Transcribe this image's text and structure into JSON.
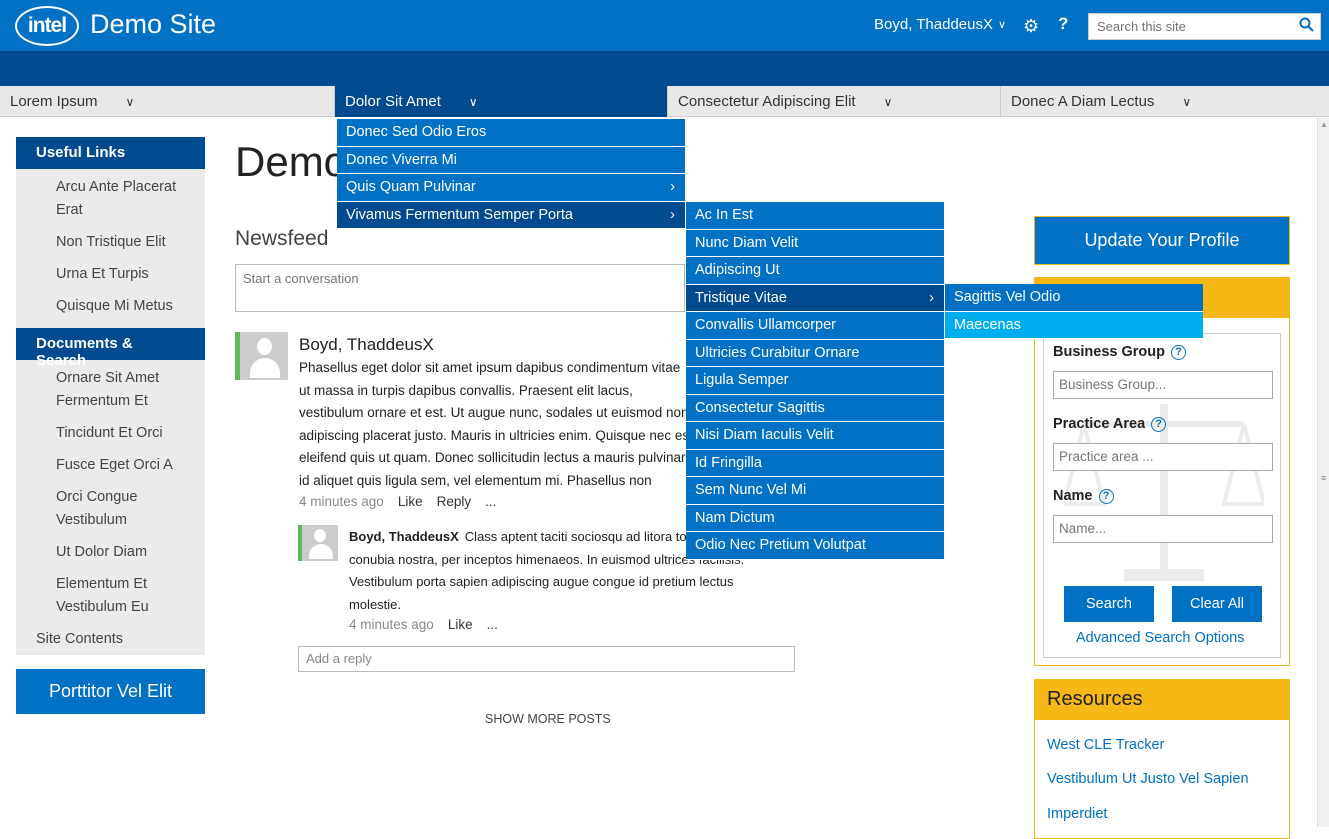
{
  "header": {
    "logo_text": "intel",
    "site_title": "Demo Site",
    "user_name": "Boyd, ThaddeusX",
    "help_label": "?",
    "search_placeholder": "Search this site"
  },
  "nav": {
    "items": [
      {
        "label": "Lorem Ipsum"
      },
      {
        "label": "Dolor Sit Amet"
      },
      {
        "label": "Consectetur Adipiscing Elit"
      },
      {
        "label": "Donec A Diam Lectus"
      }
    ]
  },
  "sidebar": {
    "useful_links_heading": "Useful Links",
    "useful_links": [
      "Arcu Ante Placerat Erat",
      "Non Tristique Elit",
      "Urna Et Turpis",
      "Quisque Mi Metus"
    ],
    "docs_heading": "Documents & Search",
    "docs_links": [
      "Ornare Sit Amet Fermentum Et",
      "Tincidunt Et Orci",
      "Fusce Eget Orci A",
      "Orci Congue Vestibulum",
      "Ut Dolor Diam",
      "Elementum Et Vestibulum Eu"
    ],
    "site_contents": "Site Contents",
    "cta_label": "Porttitor Vel Elit"
  },
  "main": {
    "page_title": "Demo",
    "newsfeed_heading": "Newsfeed",
    "conversation_placeholder": "Start a conversation",
    "post": {
      "author": "Boyd, ThaddeusX",
      "text": "Phasellus eget dolor sit amet ipsum dapibus condimentum vitae ut massa in turpis dapibus convallis. Praesent elit lacus, vestibulum ornare et est. Ut augue nunc, sodales ut euismod non, adipiscing placerat justo. Mauris in ultricies enim. Quisque nec est eleifend quis ut quam. Donec sollicitudin lectus a mauris pulvinar id aliquet quis ligula sem, vel elementum mi. Phasellus non ullamcorper u",
      "time": "4 minutes ago",
      "like": "Like",
      "reply": "Reply",
      "more": "..."
    },
    "reply": {
      "author": "Boyd, ThaddeusX",
      "text": "Class aptent taciti sociosqu ad litora torquent per conubia nostra, per inceptos himenaeos. In euismod ultrices facilisis. Vestibulum porta sapien adipiscing augue congue id pretium lectus molestie.",
      "time": "4 minutes ago",
      "like": "Like",
      "more": "..."
    },
    "add_reply_placeholder": "Add a reply",
    "show_more": "SHOW MORE POSTS"
  },
  "dropdown_level1": [
    "Donec Sed Odio Eros",
    "Donec Viverra Mi",
    "Quis Quam Pulvinar",
    "Vivamus Fermentum Semper Porta"
  ],
  "dropdown_level2": [
    "Ac In Est",
    "Nunc Diam Velit",
    "Adipiscing Ut",
    "Tristique Vitae",
    "Convallis Ullamcorper",
    "Ultricies Curabitur Ornare",
    "Ligula Semper",
    "Consectetur Sagittis",
    "Nisi Diam Iaculis Velit",
    "Id Fringilla",
    "Sem Nunc Vel Mi",
    "Nam Dictum",
    "Odio Nec Pretium Volutpat"
  ],
  "dropdown_level3": [
    "Sagittis Vel Odio",
    "Maecenas"
  ],
  "right": {
    "update_profile": "Update Your Profile",
    "business_group_label": "Business Group",
    "business_group_placeholder": "Business Group...",
    "practice_area_label": "Practice Area",
    "practice_area_placeholder": "Practice area ...",
    "name_label": "Name",
    "name_placeholder": "Name...",
    "search_btn": "Search",
    "clear_btn": "Clear All",
    "advanced_link": "Advanced Search Options",
    "resources_heading": "Resources",
    "resources_links": [
      "West CLE Tracker",
      "Vestibulum Ut Justo Vel Sapien",
      "Imperdiet"
    ]
  },
  "colors": {
    "brand_blue": "#0071c5",
    "dark_blue": "#004a8f",
    "accent_yellow": "#f5b817",
    "highlight_cyan": "#00aeef"
  }
}
